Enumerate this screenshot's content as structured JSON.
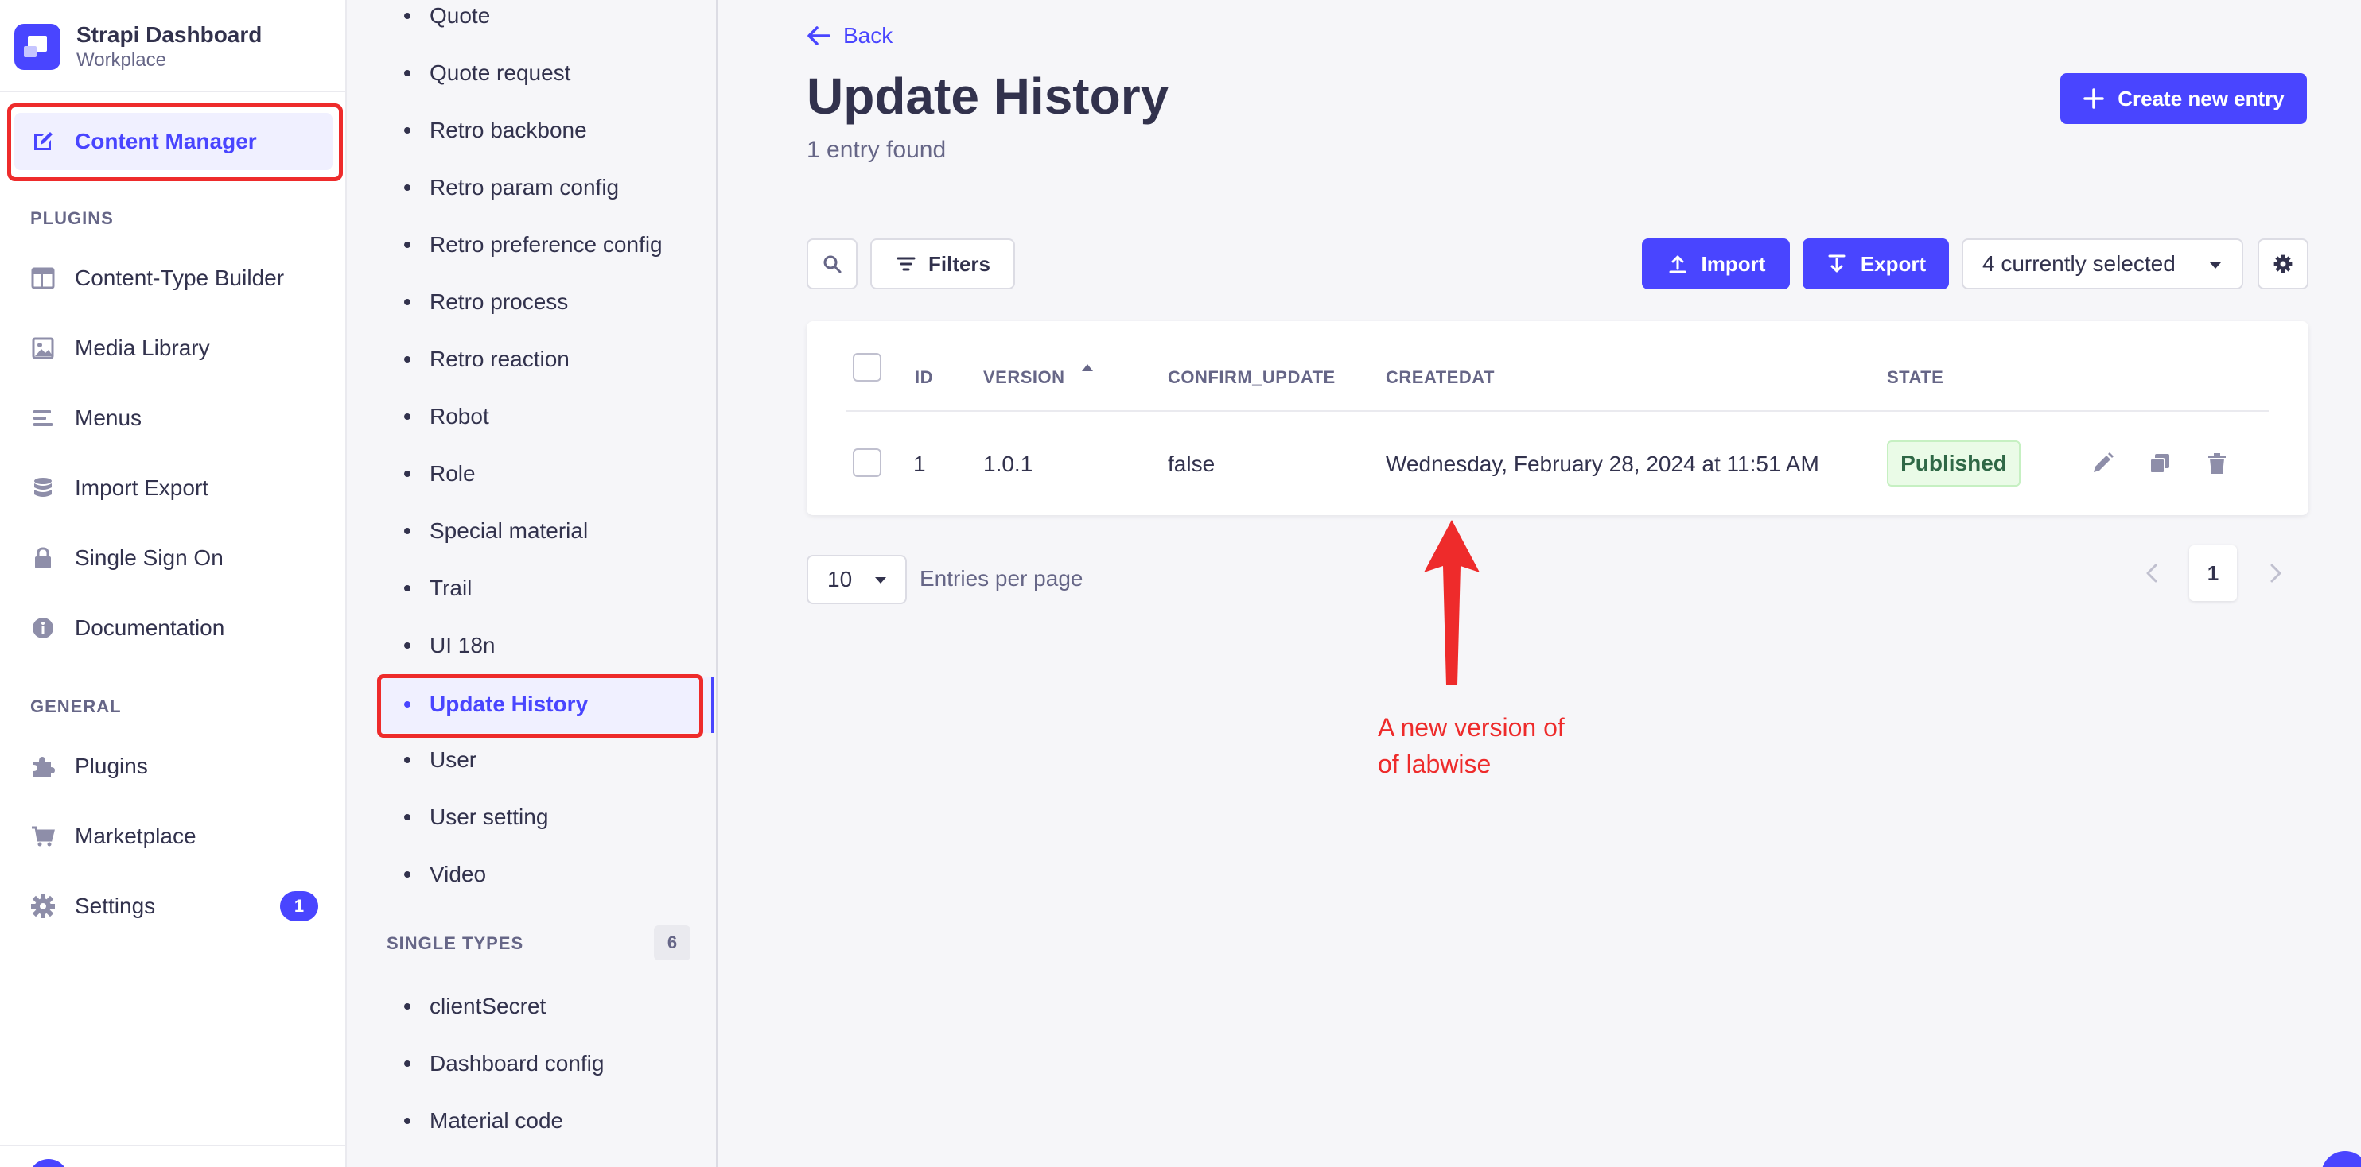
{
  "brand": {
    "name": "Strapi Dashboard",
    "subtitle": "Workplace"
  },
  "main_nav": {
    "active": {
      "label": "Content Manager",
      "icon": "feather-icon"
    },
    "plugins_title": "PLUGINS",
    "plugins": [
      {
        "label": "Content-Type Builder",
        "icon": "layout-icon"
      },
      {
        "label": "Media Library",
        "icon": "image-icon"
      },
      {
        "label": "Menus",
        "icon": "menu-icon"
      },
      {
        "label": "Import Export",
        "icon": "database-icon"
      },
      {
        "label": "Single Sign On",
        "icon": "lock-icon"
      },
      {
        "label": "Documentation",
        "icon": "info-icon"
      }
    ],
    "general_title": "GENERAL",
    "general": [
      {
        "label": "Plugins",
        "icon": "puzzle-icon"
      },
      {
        "label": "Marketplace",
        "icon": "cart-icon"
      },
      {
        "label": "Settings",
        "icon": "gear-icon",
        "badge": "1"
      }
    ]
  },
  "sub_nav": {
    "collection_types": [
      "Quote",
      "Quote request",
      "Retro backbone",
      "Retro param config",
      "Retro preference config",
      "Retro process",
      "Retro reaction",
      "Robot",
      "Role",
      "Special material",
      "Trail",
      "UI 18n",
      "Update History",
      "User",
      "User setting",
      "Video"
    ],
    "active": "Update History",
    "single_types_title": "SINGLE TYPES",
    "single_types_count": "6",
    "single_types": [
      "clientSecret",
      "Dashboard config",
      "Material code"
    ]
  },
  "header": {
    "back_label": "Back",
    "title": "Update History",
    "subtitle": "1 entry found",
    "create_label": "Create new entry"
  },
  "toolbar": {
    "filters_label": "Filters",
    "import_label": "Import",
    "export_label": "Export",
    "columns_selected": "4 currently selected"
  },
  "table": {
    "columns": [
      "ID",
      "VERSION",
      "CONFIRM_UPDATE",
      "CREATEDAT",
      "STATE"
    ],
    "sort_column": "VERSION",
    "rows": [
      {
        "id": "1",
        "version": "1.0.1",
        "confirm_update": "false",
        "createdat": "Wednesday, February 28, 2024 at 11:51 AM",
        "state": "Published"
      }
    ]
  },
  "pagination": {
    "per_page": "10",
    "per_page_label": "Entries per page",
    "current_page": "1"
  },
  "annotation": {
    "line1": "A new version of",
    "line2": "of labwise",
    "color": "#ee2b2b"
  },
  "colors": {
    "primary": "#4945ff",
    "success_text": "#2f6846",
    "success_bg": "#eafbe7",
    "highlight": "#ee2b2b"
  }
}
